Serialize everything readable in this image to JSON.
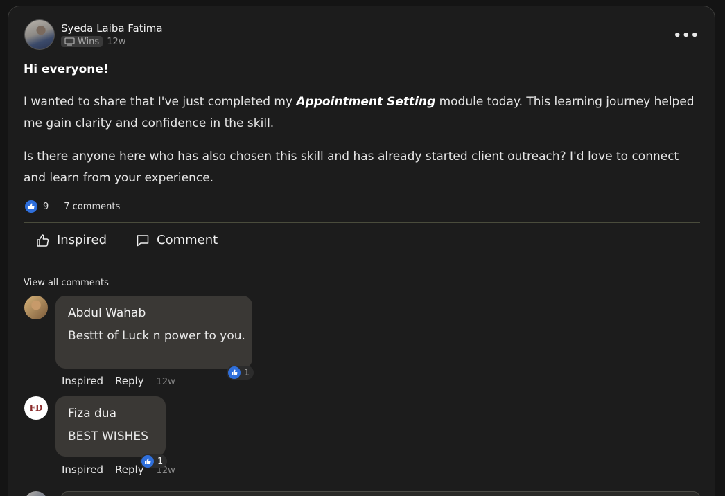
{
  "post": {
    "author": "Syeda Laiba Fatima",
    "category": "Wins",
    "age": "12w",
    "greeting": "Hi everyone!",
    "paragraph1_before": "I wanted to share that I've just completed my ",
    "paragraph1_emphasis": "Appointment Setting",
    "paragraph1_after": " module today. This learning journey helped me gain clarity and confidence in the skill.",
    "paragraph2": "Is there anyone here who has also chosen this skill and has already started client outreach? I'd love to connect and learn from your experience.",
    "reaction_count": "9",
    "comments_count": "7 comments"
  },
  "actions": {
    "inspired_label": "Inspired",
    "comment_label": "Comment"
  },
  "comments_section": {
    "view_all_label": "View all comments",
    "comments": [
      {
        "name": "Abdul Wahab",
        "text": "Besttt of Luck n power to you.",
        "reaction_count": "1",
        "inspired_label": "Inspired",
        "reply_label": "Reply",
        "age": "12w"
      },
      {
        "avatar_initials": "FD",
        "name": "Fiza dua",
        "text": "BEST WISHES",
        "reaction_count": "1",
        "inspired_label": "Inspired",
        "reply_label": "Reply",
        "age": "12w"
      }
    ]
  },
  "colors": {
    "background": "#141414",
    "card": "#1c1c1c",
    "bubble": "#3a3835",
    "like_blue": "#2f6fdb",
    "divider": "#4a4c3c"
  }
}
